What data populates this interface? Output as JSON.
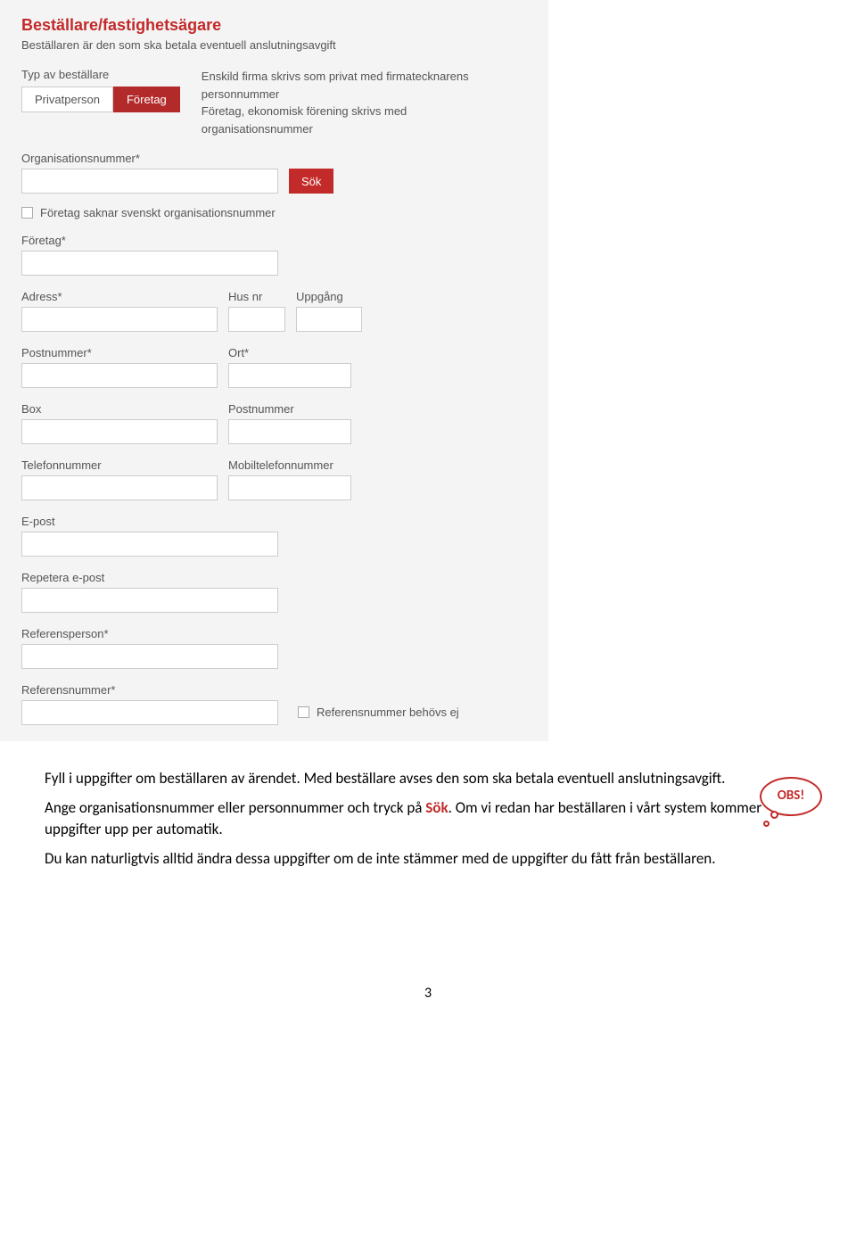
{
  "form": {
    "title": "Beställare/fastighetsägare",
    "desc": "Beställaren är den som ska betala eventuell anslutningsavgift",
    "type_label": "Typ av beställare",
    "tab_privat": "Privatperson",
    "tab_foretag": "Företag",
    "type_info": "Enskild firma skrivs som privat med firmatecknarens personnummer\nFöretag, ekonomisk förening skrivs med organisationsnummer",
    "orgnr_label": "Organisationsnummer*",
    "sok_btn": "Sök",
    "no_orgnr_label": "Företag saknar svenskt organisationsnummer",
    "foretag_label": "Företag*",
    "adress_label": "Adress*",
    "husnr_label": "Hus nr",
    "uppgang_label": "Uppgång",
    "postnr_label": "Postnummer*",
    "ort_label": "Ort*",
    "box_label": "Box",
    "box_postnr_label": "Postnummer",
    "tel_label": "Telefonnummer",
    "mobil_label": "Mobiltelefonnummer",
    "epost_label": "E-post",
    "repeat_epost_label": "Repetera e-post",
    "refperson_label": "Referensperson*",
    "refnr_label": "Referensnummer*",
    "refnr_not_needed": "Referensnummer behövs ej"
  },
  "instructions": {
    "p1": "Fyll i uppgifter om beställaren av ärendet. Med beställare avses den som ska betala eventuell anslutningsavgift.",
    "p2_pre": "Ange organisationsnummer eller personnummer och tryck på ",
    "p2_sok": "Sök",
    "p2_post": ". Om vi redan har beställaren i vårt system kommer uppgifter upp per automatik.",
    "p3": "Du kan naturligtvis alltid ändra dessa uppgifter om de inte stämmer med de uppgifter du fått från beställaren.",
    "obs": "OBS!"
  },
  "page_number": "3"
}
